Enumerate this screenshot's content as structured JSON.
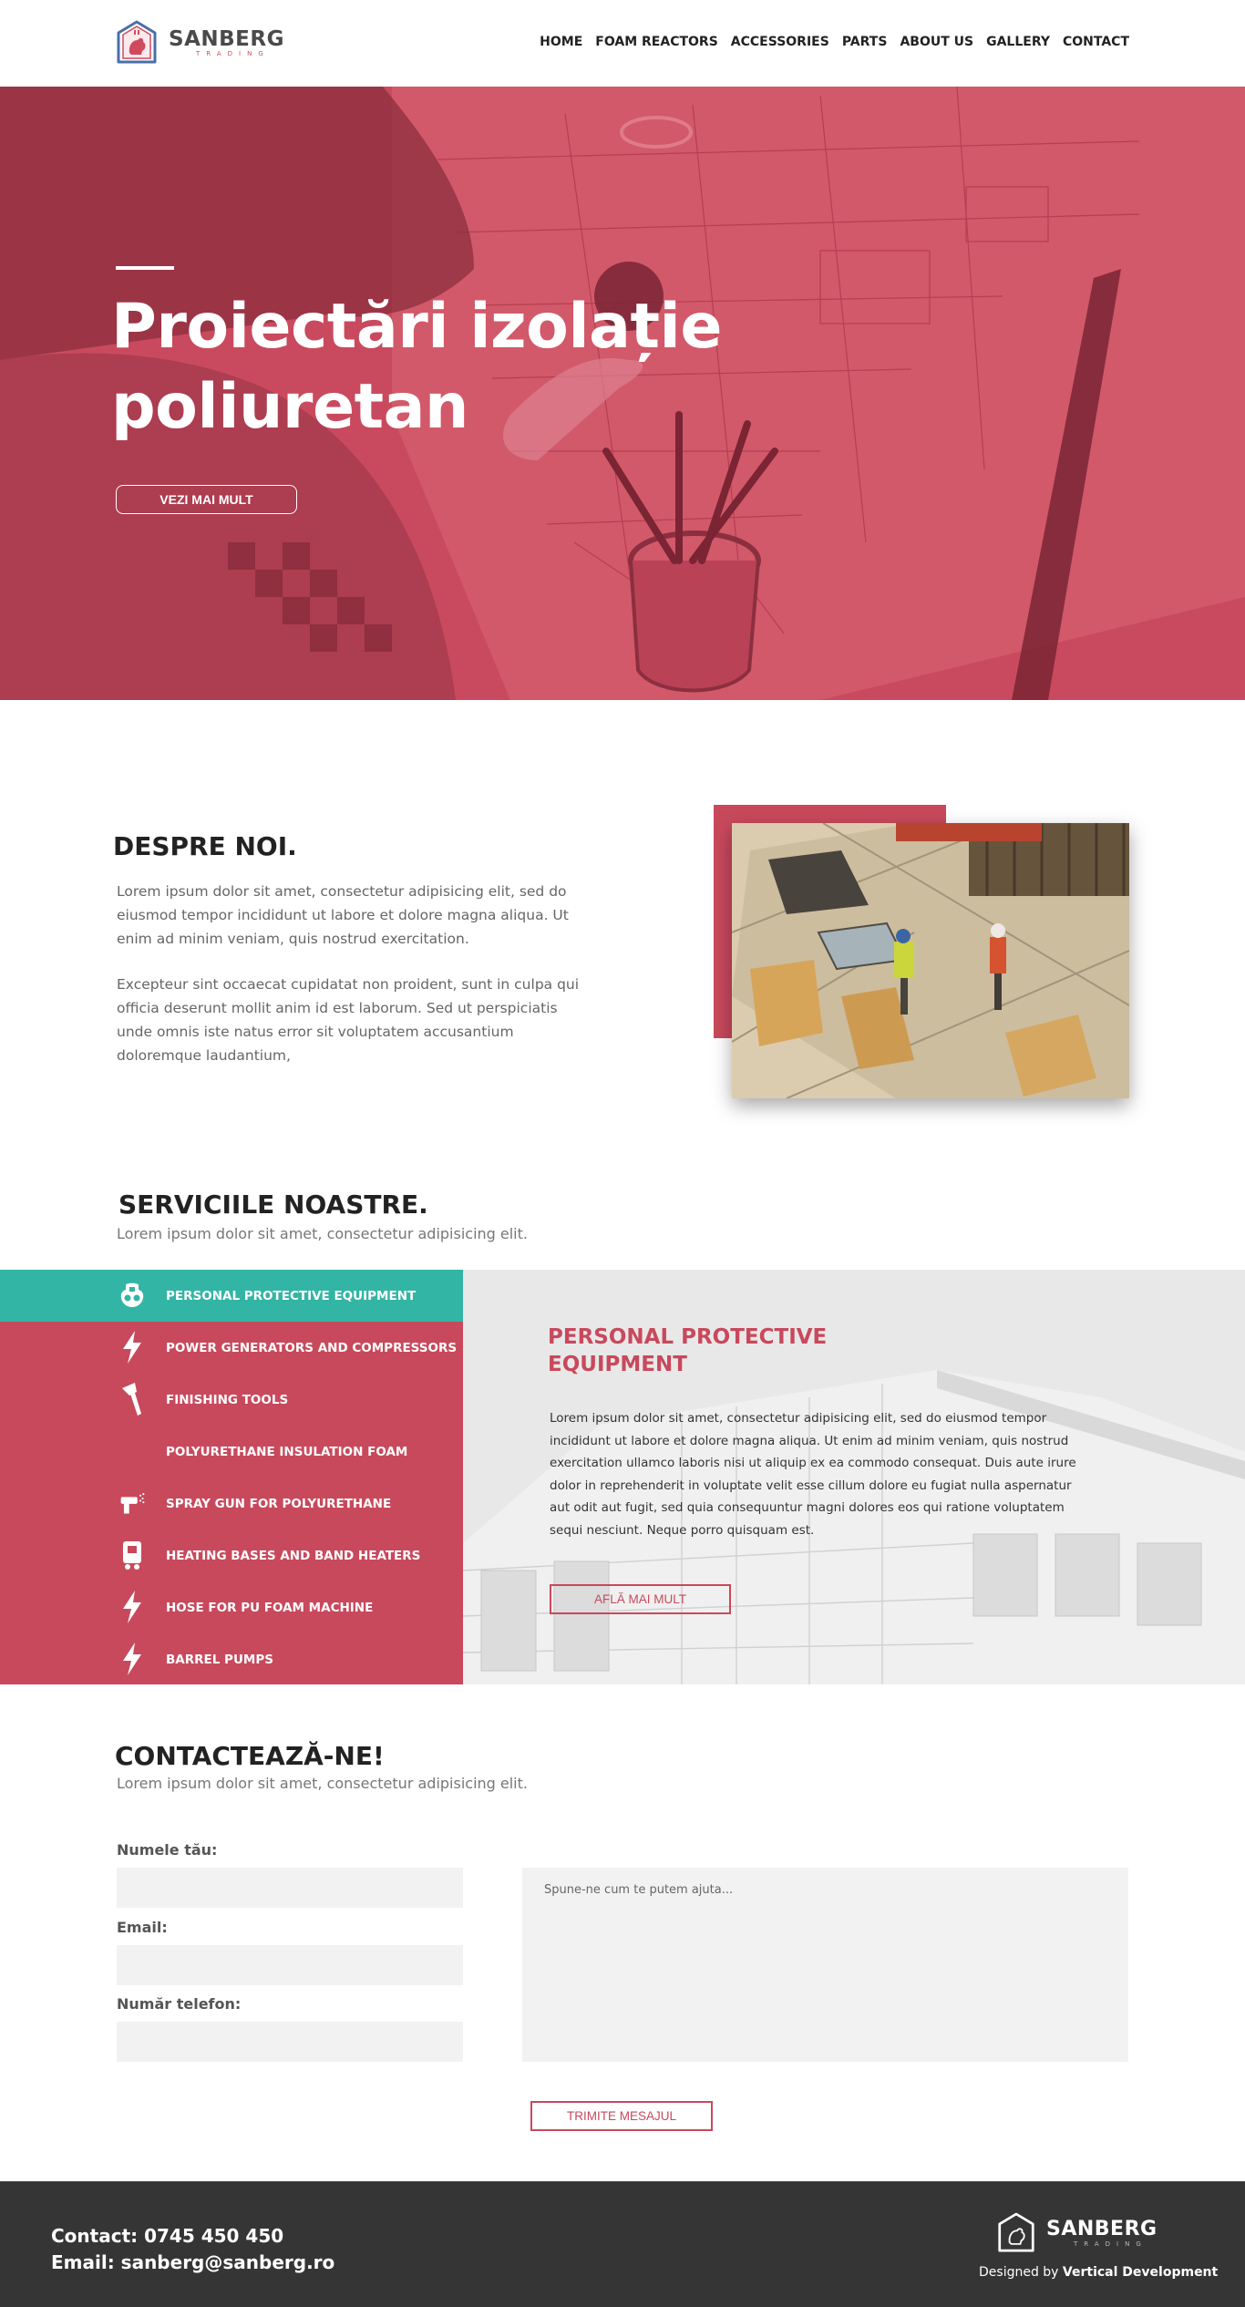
{
  "brand": {
    "name": "SANBERG",
    "sub": "TRADING"
  },
  "nav": [
    "HOME",
    "FOAM REACTORS",
    "ACCESSORIES",
    "PARTS",
    "ABOUT US",
    "GALLERY",
    "CONTACT"
  ],
  "hero": {
    "title": "Proiectări izolație poliuretan",
    "button": "VEZI MAI MULT"
  },
  "about": {
    "title": "DESPRE NOI.",
    "p1": "Lorem ipsum dolor sit amet, consectetur adipisicing elit, sed do eiusmod tempor incididunt ut labore et dolore magna aliqua. Ut enim ad minim veniam, quis nostrud exercitation.",
    "p2": "Excepteur sint occaecat cupidatat non proident, sunt in culpa qui officia deserunt mollit anim id est laborum. Sed ut perspiciatis unde omnis iste natus error sit voluptatem accusantium doloremque laudantium,"
  },
  "services": {
    "title": "SERVICIILE NOASTRE.",
    "subtitle": "Lorem ipsum dolor sit amet, consectetur adipisicing elit.",
    "items": [
      {
        "label": "PERSONAL PROTECTIVE EQUIPMENT",
        "icon": "mask-icon"
      },
      {
        "label": "POWER GENERATORS AND COMPRESSORS",
        "icon": "lightning-icon"
      },
      {
        "label": "FINISHING TOOLS",
        "icon": "tool-icon"
      },
      {
        "label": "POLYURETHANE INSULATION FOAM",
        "icon": ""
      },
      {
        "label": "SPRAY GUN FOR POLYURETHANE",
        "icon": "spray-gun-icon"
      },
      {
        "label": "HEATING BASES AND BAND HEATERS",
        "icon": "heater-icon"
      },
      {
        "label": "HOSE FOR PU FOAM MACHINE",
        "icon": "lightning-icon"
      },
      {
        "label": "BARREL PUMPS",
        "icon": "lightning-icon"
      }
    ],
    "panel": {
      "title": "PERSONAL PROTECTIVE EQUIPMENT",
      "text": "Lorem ipsum dolor sit amet, consectetur adipisicing elit, sed do eiusmod tempor incididunt ut labore et dolore magna aliqua. Ut enim ad minim veniam, quis nostrud exercitation ullamco laboris nisi ut aliquip ex ea commodo consequat. Duis aute irure dolor in reprehenderit in voluptate velit esse cillum dolore eu fugiat nulla aspernatur aut odit aut fugit, sed quia consequuntur magni dolores eos qui ratione voluptatem sequi nesciunt. Neque porro quisquam est.",
      "button": "AFLĂ MAI MULT"
    }
  },
  "contact": {
    "title": "CONTACTEAZĂ-NE!",
    "subtitle": "Lorem ipsum dolor sit amet, consectetur adipisicing elit.",
    "name_label": "Numele tău:",
    "email_label": "Email:",
    "phone_label": "Număr telefon:",
    "message_placeholder": "Spune-ne cum te putem ajuta...",
    "button": "TRIMITE MESAJUL"
  },
  "footer": {
    "contact_line": "Contact: 0745 450 450",
    "email_line": "Email: sanberg@sanberg.ro",
    "designed_by": "Designed by",
    "designer": "Vertical Development"
  },
  "colors": {
    "accent": "#c8495c",
    "teal": "#33b5a5",
    "footer": "#353535"
  }
}
